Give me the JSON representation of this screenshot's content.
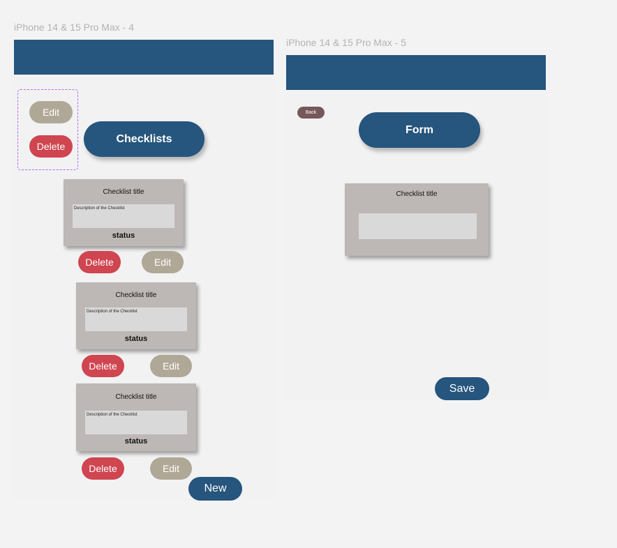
{
  "frames": [
    {
      "label": "iPhone 14 & 15 Pro Max - 4"
    },
    {
      "label": "iPhone 14 & 15 Pro Max - 5"
    }
  ],
  "list_screen": {
    "component_edit_label": "Edit",
    "component_delete_label": "Delete",
    "title_button": "Checklists",
    "checklists": [
      {
        "title": "Checklist title",
        "description": "Description of the Checklist",
        "status": "status",
        "delete_label": "Delete",
        "edit_label": "Edit"
      },
      {
        "title": "Checklist title",
        "description": "Description of the Checklist",
        "status": "status",
        "delete_label": "Delete",
        "edit_label": "Edit"
      },
      {
        "title": "Checklist title",
        "description": "Description of the Checklist",
        "status": "status",
        "delete_label": "Delete",
        "edit_label": "Edit"
      }
    ],
    "new_button": "New"
  },
  "form_screen": {
    "back_button": "Back",
    "title_button": "Form",
    "card_title": "Checklist title",
    "description_value": "",
    "save_button": "Save"
  },
  "colors": {
    "header_blue": "#26557d",
    "edit_tan": "#b0a896",
    "delete_red": "#cf4550",
    "back_brown": "#76585a",
    "card_gray": "#bdb7b5",
    "field_gray": "#d9d9d9",
    "selection_purple": "#b466f0"
  }
}
